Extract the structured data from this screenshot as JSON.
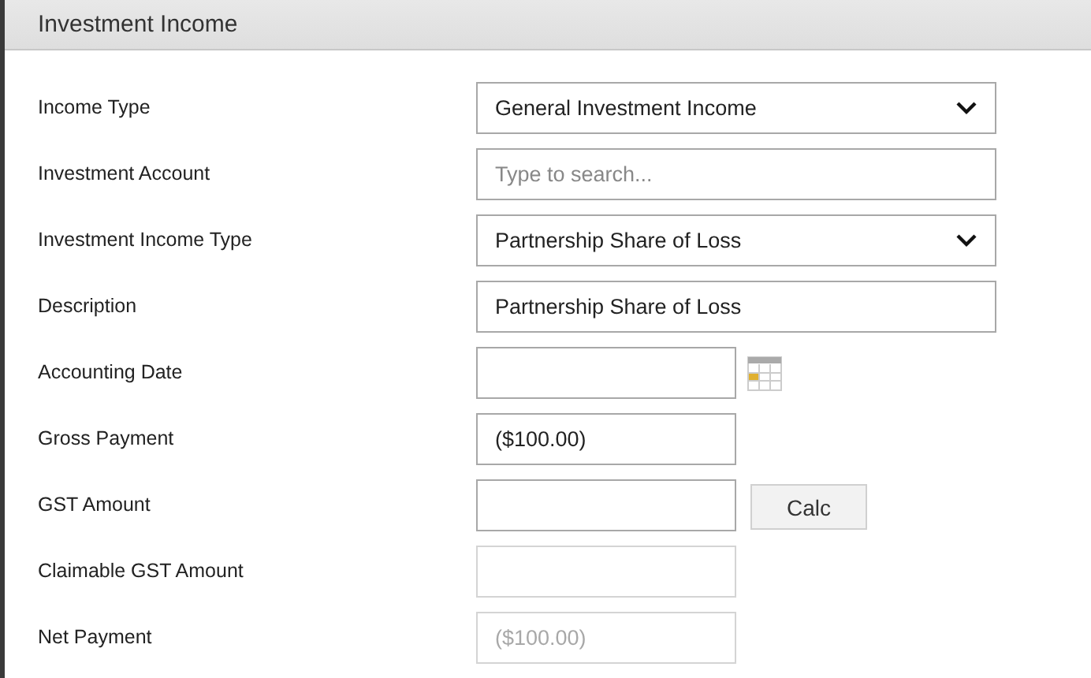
{
  "dialog": {
    "title": "Investment Income"
  },
  "fields": [
    {
      "label": "Income Type",
      "kind": "select",
      "value": "General Investment Income",
      "disabled": false
    },
    {
      "label": "Investment Account",
      "kind": "lookup",
      "placeholder": "Type to search...",
      "disabled": false
    },
    {
      "label": "Investment Income Type",
      "kind": "select",
      "value": "Partnership Share of Loss",
      "disabled": false
    },
    {
      "label": "Description",
      "kind": "text",
      "value": "Partnership Share of Loss",
      "disabled": false
    },
    {
      "label": "Accounting Date",
      "kind": "date",
      "disabled": false
    },
    {
      "label": "Gross Payment",
      "kind": "amount",
      "value": "($100.00)",
      "disabled": false
    },
    {
      "label": "GST Amount",
      "kind": "amount",
      "button": "Calc",
      "disabled": false
    },
    {
      "label": "Claimable GST Amount",
      "kind": "amount",
      "disabled": true
    },
    {
      "label": "Net Payment",
      "kind": "amount",
      "value": "($100.00)",
      "disabled": true
    }
  ]
}
